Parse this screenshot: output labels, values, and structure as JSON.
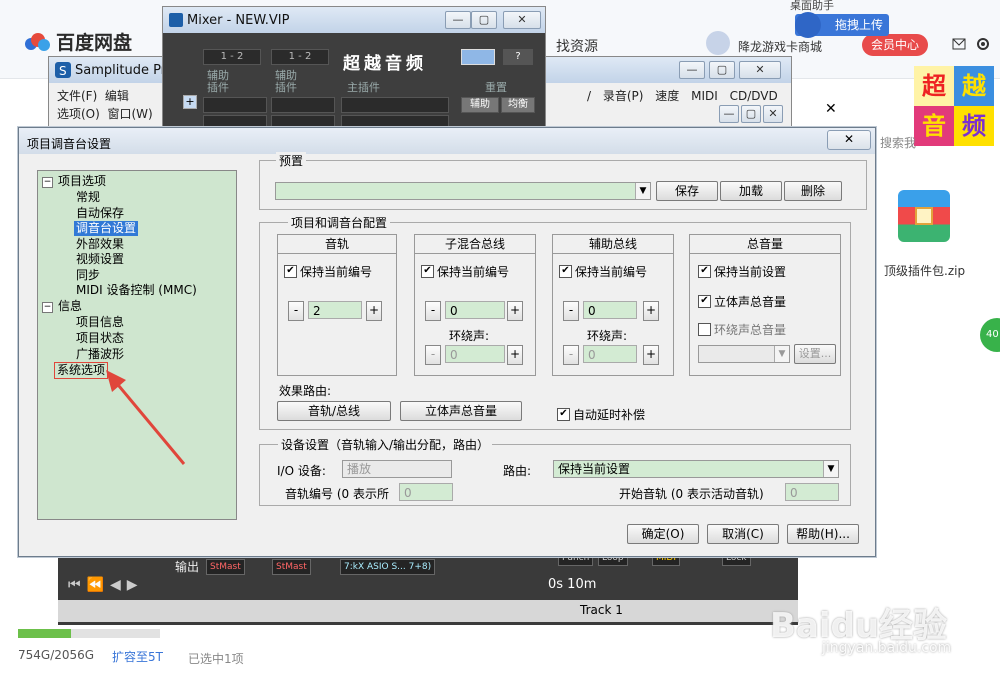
{
  "baidu": {
    "app_name": "百度网盘",
    "find_resources": "找资源",
    "user_name": "降龙游戏卡商城",
    "vip_center": "会员中心",
    "upload_btn": "拖拽上传",
    "helper": "桌面助手",
    "search": "搜索我",
    "zip_name": "顶级插件包.zip",
    "space_used": "754G/2056G",
    "expand": "扩容至5T",
    "selected": "已选中1项",
    "side_badge": "40",
    "space_ratio": 0.37
  },
  "logo": {
    "c1": "超",
    "c2": "越",
    "c3": "音",
    "c4": "频"
  },
  "mixer": {
    "title": "Mixer - NEW.VIP",
    "row1a": "1 - 2",
    "row1b": "1 - 2",
    "aux1": "辅助",
    "aux2": "辅助",
    "ins1": "插件",
    "ins2": "插件",
    "master_ins": "主插件",
    "reset": "重置",
    "aux_btn": "辅助",
    "eq_btn": "均衡",
    "q": "?",
    "brand": "超越音频"
  },
  "samplitude": {
    "title": "Samplitude Pro",
    "menu1": "文件(F)",
    "menu2": "编辑",
    "menu3": "选项(O)",
    "menu4": "窗口(W)",
    "menu_right": "/ 录音(P)  速度  MIDI  CD/DVD"
  },
  "daw": {
    "output": "输出",
    "pill1": "StMast",
    "pill2": "StMast",
    "pill3": "7:kX ASIO S... 7+8)",
    "track": "Track 1",
    "punch": "Punch",
    "loop": "Loop",
    "midi": "MIDI",
    "lock": "Lock",
    "time": "0s 10m"
  },
  "dialog": {
    "title": "项目调音台设置",
    "tree": {
      "project_options": "项目选项",
      "general": "常规",
      "autosave": "自动保存",
      "mixer_settings": "调音台设置",
      "external_fx": "外部效果",
      "video": "视频设置",
      "sync": "同步",
      "midi_mmc": "MIDI 设备控制 (MMC)",
      "info": "信息",
      "project_info": "项目信息",
      "project_status": "项目状态",
      "broadcast_wave": "广播波形",
      "system_options": "系统选项"
    },
    "preset": {
      "legend": "预置",
      "save": "保存",
      "load": "加载",
      "delete": "删除"
    },
    "config_legend": "项目和调音台配置",
    "tracks": {
      "head": "音轨",
      "keep": "保持当前编号",
      "value": "2"
    },
    "submix": {
      "head": "子混合总线",
      "keep": "保持当前编号",
      "value": "0",
      "surround": "环绕声:",
      "surround_value": "0"
    },
    "aux": {
      "head": "辅助总线",
      "keep": "保持当前编号",
      "value": "0",
      "surround": "环绕声:",
      "surround_value": "0"
    },
    "master": {
      "head": "总音量",
      "keep": "保持当前设置",
      "stereo": "立体声总音量",
      "surround": "环绕声总音量",
      "settings": "设置..."
    },
    "routing_label": "效果路由:",
    "btn_track_bus": "音轨/总线",
    "btn_stereo_master": "立体声总音量",
    "auto_delay": "自动延时补偿",
    "device": {
      "legend": "设备设置（音轨输入/输出分配，路由）",
      "io_label": "I/O 设备:",
      "io_value": "播放",
      "route_label": "路由:",
      "route_value": "保持当前设置",
      "track_num_label": "音轨编号 (0 表示所",
      "track_num_value": "0",
      "start_track_label": "开始音轨 (0 表示活动音轨)",
      "start_track_value": "0"
    },
    "ok": "确定(O)",
    "cancel": "取消(C)",
    "help": "帮助(H)...",
    "close": "✕"
  },
  "watermark": {
    "main": "Baidu经验",
    "sub": "jingyan.baidu.com"
  },
  "colors": {
    "accent": "#3179d6",
    "tree_bg": "#cfe6cf",
    "field_bg": "#d3ebd3",
    "arrow": "#e0463b"
  }
}
